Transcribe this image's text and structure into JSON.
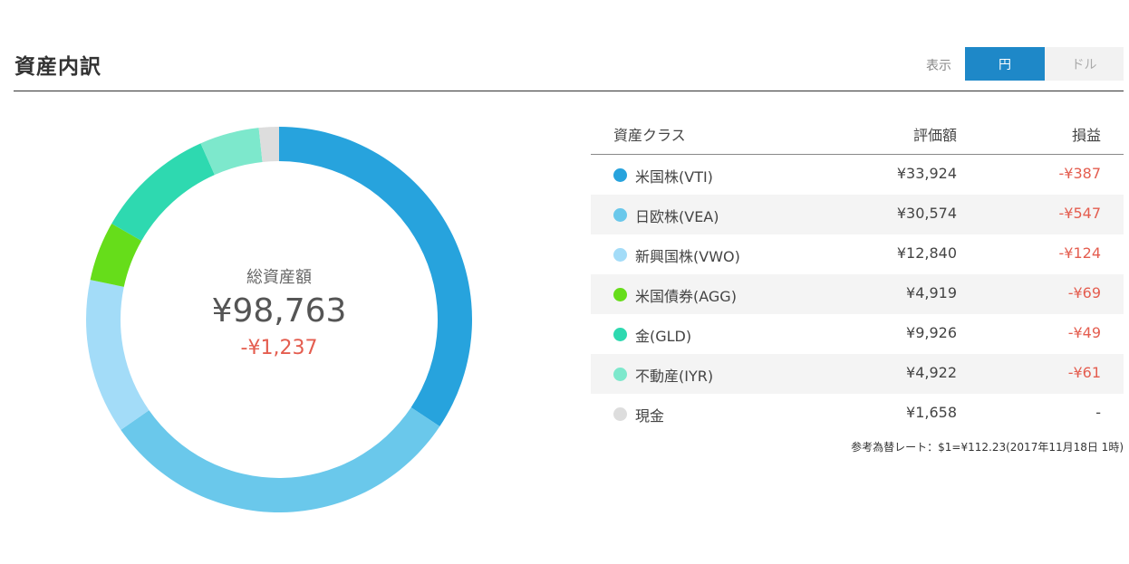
{
  "page": {
    "title": "資産内訳"
  },
  "toggle": {
    "label": "表示",
    "options": [
      "円",
      "ドル"
    ],
    "selected": "円"
  },
  "summary": {
    "title": "総資産額",
    "total": "¥98,763",
    "delta": "-¥1,237"
  },
  "table": {
    "headers": {
      "asset_class": "資産クラス",
      "value": "評価額",
      "pl": "損益"
    },
    "rows": [
      {
        "name": "米国株(VTI)",
        "value": "¥33,924",
        "pl": "-¥387",
        "color": "#27a3dd"
      },
      {
        "name": "日欧株(VEA)",
        "value": "¥30,574",
        "pl": "-¥547",
        "color": "#6ac8eb"
      },
      {
        "name": "新興国株(VWO)",
        "value": "¥12,840",
        "pl": "-¥124",
        "color": "#a3dcf8"
      },
      {
        "name": "米国債券(AGG)",
        "value": "¥4,919",
        "pl": "-¥69",
        "color": "#66dd1a"
      },
      {
        "name": "金(GLD)",
        "value": "¥9,926",
        "pl": "-¥49",
        "color": "#2ed9b0"
      },
      {
        "name": "不動産(IYR)",
        "value": "¥4,922",
        "pl": "-¥61",
        "color": "#7de8cc"
      },
      {
        "name": "現金",
        "value": "¥1,658",
        "pl": "-",
        "color": "#dddddd"
      }
    ]
  },
  "note": "参考為替レート：$1=¥112.23(2017年11月18日 1時)",
  "chart_data": {
    "type": "pie",
    "categories": [
      "米国株(VTI)",
      "日欧株(VEA)",
      "新興国株(VWO)",
      "米国債券(AGG)",
      "金(GLD)",
      "不動産(IYR)",
      "現金"
    ],
    "values": [
      33924,
      30574,
      12840,
      4919,
      9926,
      4922,
      1658
    ],
    "colors": [
      "#27a3dd",
      "#6ac8eb",
      "#a3dcf8",
      "#66dd1a",
      "#2ed9b0",
      "#7de8cc",
      "#dddddd"
    ],
    "title": "",
    "donut": true
  }
}
